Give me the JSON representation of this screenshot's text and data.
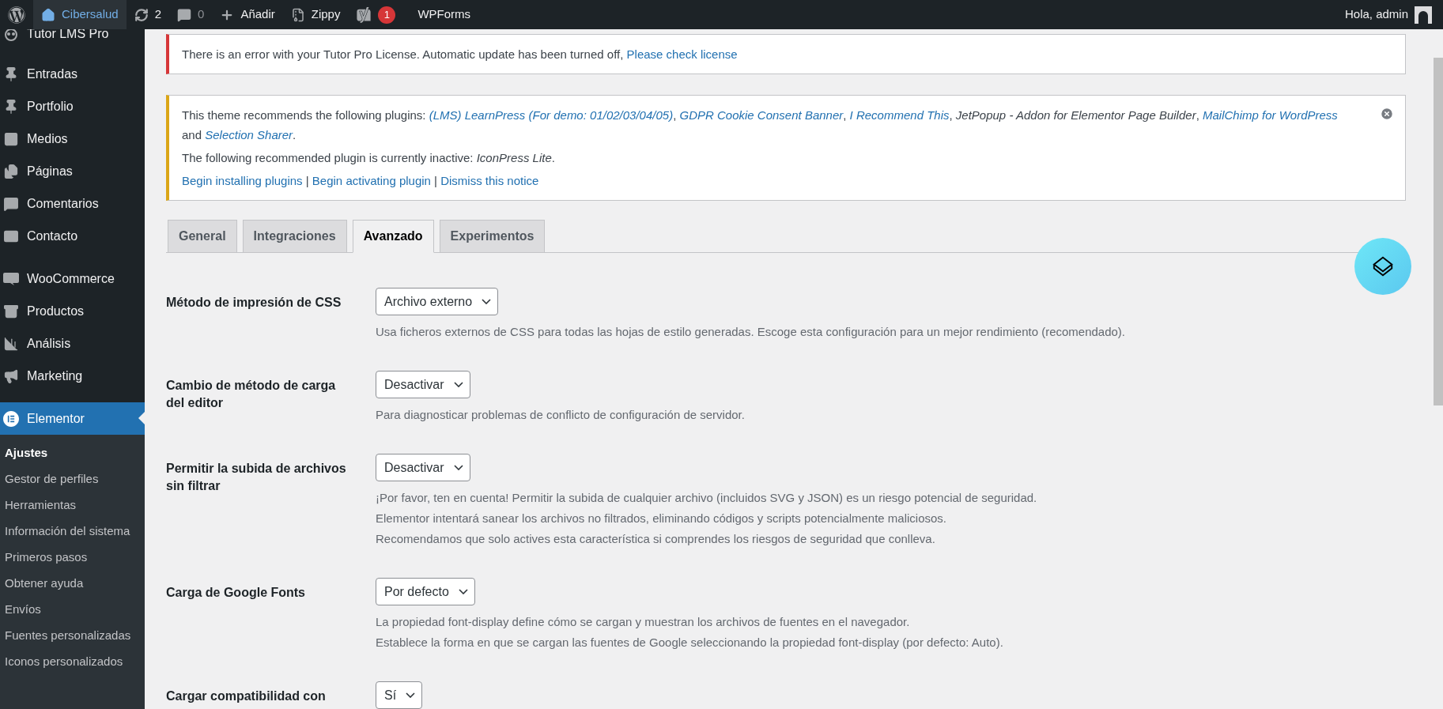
{
  "admin_bar": {
    "items": [
      {
        "kind": "wordpress"
      },
      {
        "kind": "site",
        "label": "Cibersalud",
        "selected": true
      },
      {
        "kind": "updates",
        "label": "2"
      },
      {
        "kind": "comments",
        "label": "0"
      },
      {
        "kind": "new",
        "label": "Añadir"
      },
      {
        "kind": "zippy",
        "label": "Zippy"
      },
      {
        "kind": "yoast",
        "label": "1"
      },
      {
        "kind": "text",
        "label": "WPForms"
      }
    ],
    "greeting": "Hola, admin"
  },
  "sidebar": {
    "top_item": {
      "label": "Tutor LMS Pro"
    },
    "groups": [
      [
        {
          "label": "Entradas",
          "selected": false
        },
        {
          "label": "Portfolio",
          "selected": false
        },
        {
          "label": "Medios",
          "selected": false
        },
        {
          "label": "Páginas",
          "selected": false
        },
        {
          "label": "Comentarios",
          "selected": false
        },
        {
          "label": "Contacto",
          "selected": false
        }
      ],
      [
        {
          "label": "WooCommerce",
          "selected": false
        },
        {
          "label": "Productos",
          "selected": false
        },
        {
          "label": "Análisis",
          "selected": false
        },
        {
          "label": "Marketing",
          "selected": false
        }
      ],
      [
        {
          "label": "Elementor",
          "selected": true
        }
      ]
    ],
    "submenu": [
      {
        "label": "Ajustes",
        "selected": true
      },
      {
        "label": "Gestor de perfiles",
        "selected": false
      },
      {
        "label": "Herramientas",
        "selected": false
      },
      {
        "label": "Información del sistema",
        "selected": false
      },
      {
        "label": "Primeros pasos",
        "selected": false
      },
      {
        "label": "Obtener ayuda",
        "selected": false
      },
      {
        "label": "Envíos",
        "selected": false
      },
      {
        "label": "Fuentes personalizadas",
        "selected": false
      },
      {
        "label": "Iconos personalizados",
        "selected": false
      }
    ]
  },
  "notices": [
    {
      "kind": "error",
      "dismissible": false,
      "paragraphs": [
        [
          {
            "kind": "text",
            "text": "There is an error with your Tutor Pro License. Automatic update has been turned off, "
          },
          {
            "kind": "link",
            "text": "Please check license"
          }
        ]
      ]
    },
    {
      "kind": "warning",
      "dismissible": true,
      "paragraphs": [
        [
          {
            "kind": "text",
            "text": "This theme recommends the following plugins: "
          },
          {
            "kind": "italic-link",
            "text": "(LMS) LearnPress (For demo: 01/02/03/04/05)"
          },
          {
            "kind": "text",
            "text": ", "
          },
          {
            "kind": "italic-link",
            "text": "GDPR Cookie Consent Banner"
          },
          {
            "kind": "text",
            "text": ", "
          },
          {
            "kind": "italic-link",
            "text": "I Recommend This"
          },
          {
            "kind": "text",
            "text": ", "
          },
          {
            "kind": "italic",
            "text": "JetPopup - Addon for Elementor Page Builder"
          },
          {
            "kind": "text",
            "text": ", "
          },
          {
            "kind": "italic-link",
            "text": "MailChimp for WordPress"
          },
          {
            "kind": "text",
            "text": " and "
          },
          {
            "kind": "italic-link",
            "text": "Selection Sharer"
          },
          {
            "kind": "text",
            "text": "."
          }
        ],
        [
          {
            "kind": "text",
            "text": "The following recommended plugin is currently inactive: "
          },
          {
            "kind": "italic",
            "text": "IconPress Lite"
          },
          {
            "kind": "text",
            "text": "."
          }
        ],
        [
          {
            "kind": "link",
            "text": "Begin installing plugins"
          },
          {
            "kind": "text",
            "text": " | "
          },
          {
            "kind": "link",
            "text": "Begin activating plugin"
          },
          {
            "kind": "text",
            "text": " | "
          },
          {
            "kind": "link",
            "text": "Dismiss this notice"
          }
        ]
      ]
    }
  ],
  "tabs": [
    {
      "label": "General",
      "selected": false
    },
    {
      "label": "Integraciones",
      "selected": false
    },
    {
      "label": "Avanzado",
      "selected": true
    },
    {
      "label": "Experimentos",
      "selected": false
    }
  ],
  "settings": [
    {
      "label": "Método de impresión de CSS",
      "value": "Archivo externo",
      "description": [
        "Usa ficheros externos de CSS para todas las hojas de estilo generadas. Escoge esta configuración para un mejor rendimiento (recomendado)."
      ]
    },
    {
      "label": "Cambio de método de carga del editor",
      "value": "Desactivar",
      "description": [
        "Para diagnosticar problemas de conflicto de configuración de servidor."
      ]
    },
    {
      "label": "Permitir la subida de archivos sin filtrar",
      "value": "Desactivar",
      "description": [
        "¡Por favor, ten en cuenta! Permitir la subida de cualquier archivo (incluidos SVG y JSON) es un riesgo potencial de seguridad.",
        "Elementor intentará sanear los archivos no filtrados, eliminando códigos y scripts potencialmente maliciosos.",
        "Recomendamos que solo actives esta característica si comprendes los riesgos de seguridad que conlleva."
      ]
    },
    {
      "label": "Carga de Google Fonts",
      "value": "Por defecto",
      "description": [
        "La propiedad font-display define cómo se cargan y muestran los archivos de fuentes en el navegador.",
        "Establece la forma en que se cargan las fuentes de Google seleccionando la propiedad font-display (por defecto: Auto)."
      ]
    },
    {
      "label": "Cargar compatibilidad con",
      "value": "Sí"
    }
  ]
}
